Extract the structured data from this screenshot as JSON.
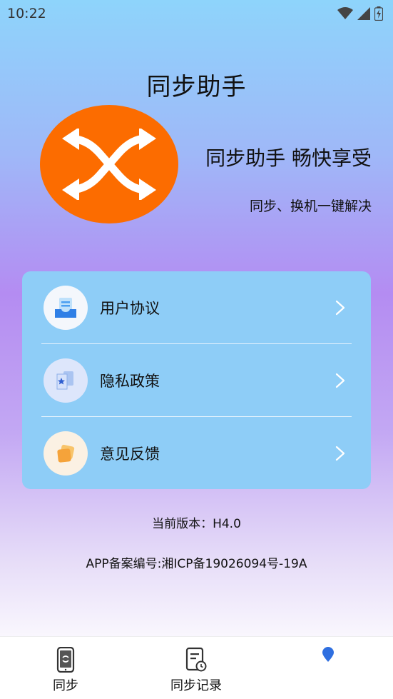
{
  "status_bar": {
    "time": "10:22",
    "icons": [
      "wifi-icon",
      "signal-icon",
      "battery-icon"
    ]
  },
  "app": {
    "title": "同步助手",
    "slogan": "同步助手 畅快享受",
    "sub_slogan": "同步、换机一键解决"
  },
  "menu": {
    "items": [
      {
        "label": "用户协议",
        "icon": "document-tray-icon"
      },
      {
        "label": "隐私政策",
        "icon": "privacy-folder-icon"
      },
      {
        "label": "意见反馈",
        "icon": "feedback-note-icon"
      }
    ]
  },
  "footer": {
    "version": "当前版本：H4.0",
    "icp": "APP备案编号:湘ICP备19026094号-19A"
  },
  "tab_bar": {
    "tabs": [
      {
        "label": "同步",
        "icon": "phone-sync-icon"
      },
      {
        "label": "同步记录",
        "icon": "record-clock-icon"
      },
      {
        "label": "",
        "icon": "location-dot-icon"
      }
    ]
  },
  "colors": {
    "logo_bg": "#fc6c00",
    "card_bg": "#8ecdf7",
    "accent_dot": "#2f6fe0"
  }
}
